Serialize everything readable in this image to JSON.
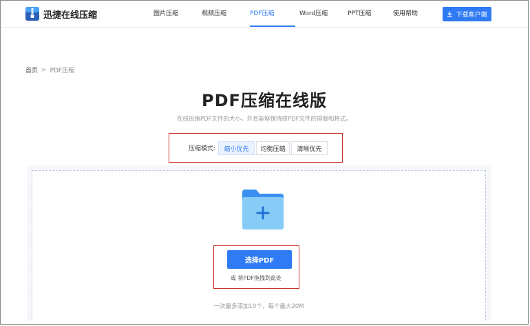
{
  "header": {
    "logo_text": "迅捷在线压缩",
    "nav": [
      {
        "label": "图片压缩",
        "active": false
      },
      {
        "label": "视频压缩",
        "active": false
      },
      {
        "label": "PDF压缩",
        "active": true
      },
      {
        "label": "Word压缩",
        "active": false
      },
      {
        "label": "PPT压缩",
        "active": false
      },
      {
        "label": "使用帮助",
        "active": false
      }
    ],
    "download_label": "下载客户端"
  },
  "breadcrumb": {
    "home": "首页",
    "separator": ">",
    "current": "PDF压缩"
  },
  "page": {
    "title": "PDF压缩在线版",
    "subtitle": "在线压缩PDF文件的大小，并且能够保持原PDF文件的排版和格式。"
  },
  "mode": {
    "label": "压缩模式:",
    "options": [
      "缩小优先",
      "均衡压缩",
      "清晰优先"
    ],
    "selected": "缩小优先"
  },
  "upload": {
    "choose_label": "选择PDF",
    "drag_hint": "或 将PDF拖拽到此处",
    "limit_note": "一次最多添加10个，每个最大20M"
  },
  "colors": {
    "accent": "#2f7bf5",
    "highlight_border": "#c9302c",
    "folder": "#7cc4f5"
  }
}
